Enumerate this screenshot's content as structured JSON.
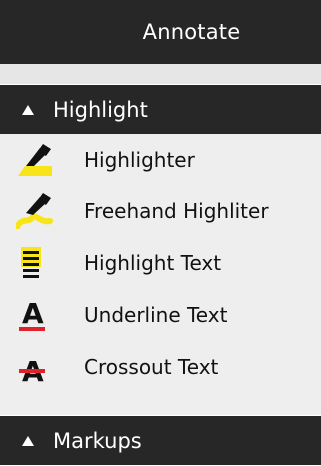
{
  "panel": {
    "title": "Annotate"
  },
  "sections": {
    "highlight": {
      "label": "Highlight",
      "items": [
        {
          "label": "Highlighter",
          "icon": "highlighter-icon"
        },
        {
          "label": "Freehand Highliter",
          "icon": "freehand-highlighter-icon"
        },
        {
          "label": "Highlight Text",
          "icon": "highlight-text-icon"
        },
        {
          "label": "Underline Text",
          "icon": "underline-text-icon"
        },
        {
          "label": "Crossout Text",
          "icon": "crossout-text-icon"
        }
      ]
    },
    "markups": {
      "label": "Markups"
    }
  },
  "colors": {
    "header_bg": "#272727",
    "item_bg": "#eeeeee",
    "highlight_yellow": "#f7e419",
    "underline_red": "#e0202a"
  }
}
